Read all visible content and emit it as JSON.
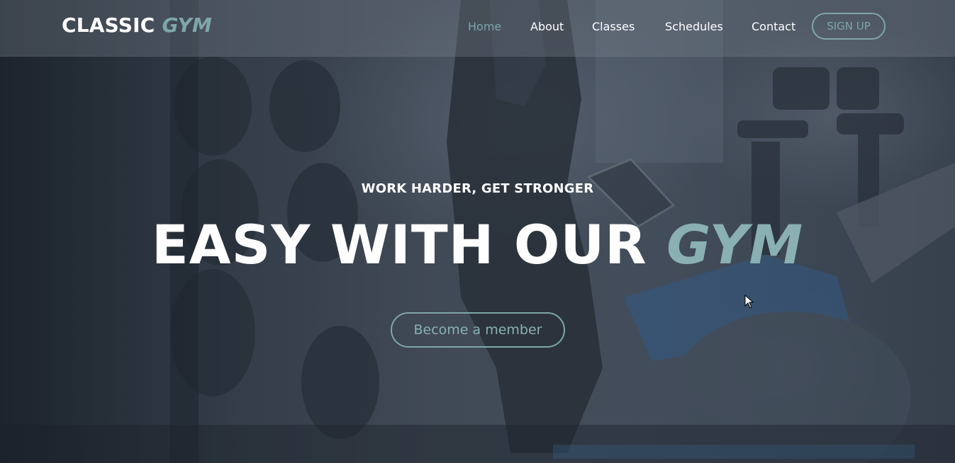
{
  "brand": {
    "name": "CLASSIC",
    "accent": "GYM"
  },
  "nav": {
    "items": [
      {
        "label": "Home",
        "active": true
      },
      {
        "label": "About",
        "active": false
      },
      {
        "label": "Classes",
        "active": false
      },
      {
        "label": "Schedules",
        "active": false
      },
      {
        "label": "Contact",
        "active": false
      }
    ],
    "signup_label": "SIGN UP"
  },
  "hero": {
    "tagline": "WORK HARDER, GET STRONGER",
    "headline_main": "EASY WITH OUR",
    "headline_accent": "GYM",
    "cta_label": "Become a member"
  },
  "colors": {
    "accent": "#7ea6a8",
    "text": "#ffffff",
    "header_bg": "rgba(120,128,140,0.35)"
  },
  "icons": {
    "cursor": "mouse-pointer-icon"
  }
}
